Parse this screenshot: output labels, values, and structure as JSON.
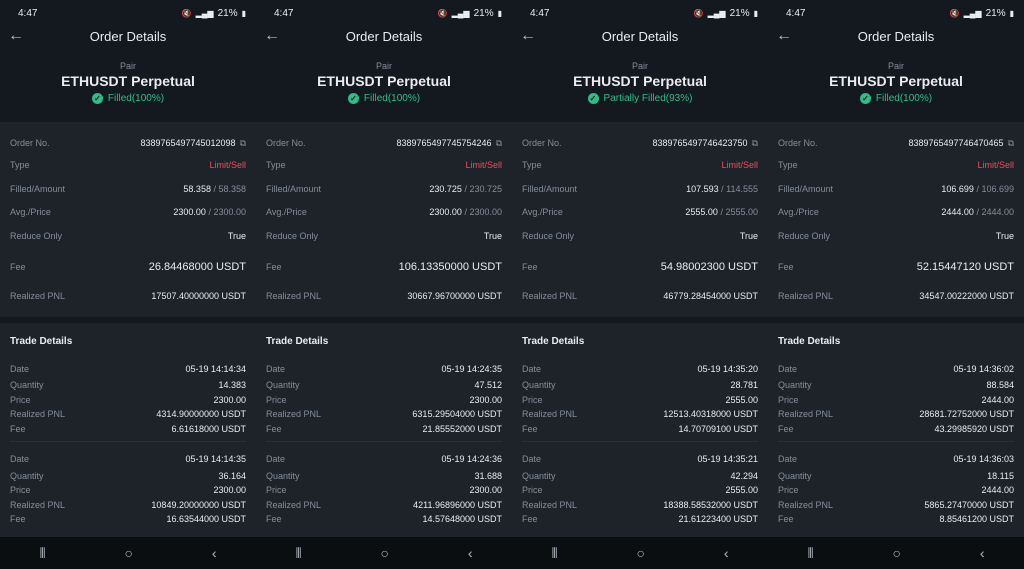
{
  "screens": [
    {
      "time": "4:47",
      "battery": "21%",
      "title": "Order Details",
      "pair_label": "Pair",
      "pair": "ETHUSDT Perpetual",
      "status": "Filled(100%)",
      "order_no": "8389765497745012098",
      "type": "Limit/Sell",
      "filled": "58.358",
      "amount": "/ 58.358",
      "avg": "2300.00",
      "price": "/ 2300.00",
      "reduce_only": "True",
      "fee": "26.84468000 USDT",
      "pnl": "17507.40000000 USDT",
      "trades": [
        {
          "date": "05-19 14:14:34",
          "quantity": "14.383",
          "price": "2300.00",
          "pnl": "4314.90000000 USDT",
          "fee": "6.61618000 USDT"
        },
        {
          "date": "05-19 14:14:35",
          "quantity": "36.164",
          "price": "2300.00",
          "pnl": "10849.20000000 USDT",
          "fee": "16.63544000 USDT"
        }
      ]
    },
    {
      "time": "4:47",
      "battery": "21%",
      "title": "Order Details",
      "pair_label": "Pair",
      "pair": "ETHUSDT Perpetual",
      "status": "Filled(100%)",
      "order_no": "8389765497745754246",
      "type": "Limit/Sell",
      "filled": "230.725",
      "amount": "/ 230.725",
      "avg": "2300.00",
      "price": "/ 2300.00",
      "reduce_only": "True",
      "fee": "106.13350000 USDT",
      "pnl": "30667.96700000 USDT",
      "trades": [
        {
          "date": "05-19 14:24:35",
          "quantity": "47.512",
          "price": "2300.00",
          "pnl": "6315.29504000 USDT",
          "fee": "21.85552000 USDT"
        },
        {
          "date": "05-19 14:24:36",
          "quantity": "31.688",
          "price": "2300.00",
          "pnl": "4211.96896000 USDT",
          "fee": "14.57648000 USDT"
        }
      ]
    },
    {
      "time": "4:47",
      "battery": "21%",
      "title": "Order Details",
      "pair_label": "Pair",
      "pair": "ETHUSDT Perpetual",
      "status": "Partially Filled(93%)",
      "order_no": "8389765497746423750",
      "type": "Limit/Sell",
      "filled": "107.593",
      "amount": "/ 114.555",
      "avg": "2555.00",
      "price": "/ 2555.00",
      "reduce_only": "True",
      "fee": "54.98002300 USDT",
      "pnl": "46779.28454000 USDT",
      "trades": [
        {
          "date": "05-19 14:35:20",
          "quantity": "28.781",
          "price": "2555.00",
          "pnl": "12513.40318000 USDT",
          "fee": "14.70709100 USDT"
        },
        {
          "date": "05-19 14:35:21",
          "quantity": "42.294",
          "price": "2555.00",
          "pnl": "18388.58532000 USDT",
          "fee": "21.61223400 USDT"
        }
      ]
    },
    {
      "time": "4:47",
      "battery": "21%",
      "title": "Order Details",
      "pair_label": "Pair",
      "pair": "ETHUSDT Perpetual",
      "status": "Filled(100%)",
      "order_no": "8389765497746470465",
      "type": "Limit/Sell",
      "filled": "106.699",
      "amount": "/ 106.699",
      "avg": "2444.00",
      "price": "/ 2444.00",
      "reduce_only": "True",
      "fee": "52.15447120 USDT",
      "pnl": "34547.00222000 USDT",
      "trades": [
        {
          "date": "05-19 14:36:02",
          "quantity": "88.584",
          "price": "2444.00",
          "pnl": "28681.72752000 USDT",
          "fee": "43.29985920 USDT"
        },
        {
          "date": "05-19 14:36:03",
          "quantity": "18.115",
          "price": "2444.00",
          "pnl": "5865.27470000 USDT",
          "fee": "8.85461200 USDT"
        }
      ]
    }
  ],
  "labels": {
    "order_no": "Order No.",
    "type": "Type",
    "filled_amount": "Filled/Amount",
    "avg_price": "Avg./Price",
    "reduce_only": "Reduce Only",
    "fee": "Fee",
    "realized_pnl": "Realized PNL",
    "trade_details": "Trade Details",
    "date": "Date",
    "quantity": "Quantity",
    "price": "Price"
  },
  "icons": {
    "back": "arrow-left-icon",
    "copy": "copy-icon",
    "check": "check-circle-icon",
    "nav_recents": "recents-icon",
    "nav_home": "home-icon",
    "nav_back": "back-icon"
  },
  "colors": {
    "accent_green": "#2ebd85",
    "sell_red": "#f6465d"
  }
}
